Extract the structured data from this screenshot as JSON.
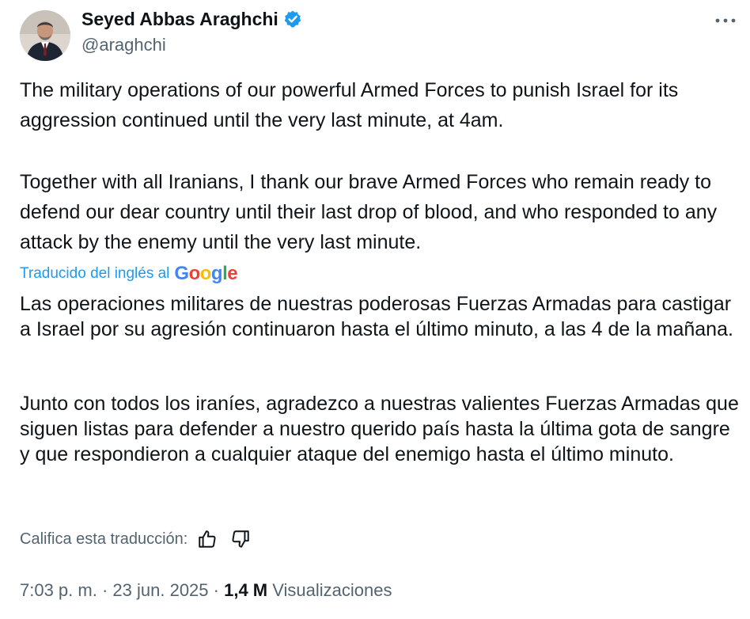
{
  "author": {
    "name": "Seyed Abbas Araghchi",
    "handle": "@araghchi",
    "verified_color": "#1d9bf0"
  },
  "tweet": {
    "paragraphs": [
      "The military operations of our powerful Armed Forces to punish Israel for its aggression continued until the very last minute, at 4am.",
      "Together with all Iranians, I thank our brave Armed Forces who remain ready to defend our dear country until their last drop of blood, and who responded to any attack by the enemy until the very last minute."
    ]
  },
  "translation": {
    "label": "Traducido del inglés al",
    "provider": "Google",
    "paragraphs": [
      "Las operaciones militares de nuestras poderosas Fuerzas Armadas para castigar a Israel por su agresión continuaron hasta el último minuto, a las 4 de la mañana.",
      "Junto con todos los iraníes, agradezco a nuestras valientes Fuerzas Armadas que siguen listas para defender a nuestro querido país hasta la última gota de sangre y que respondieron a cualquier ataque del enemigo hasta el último minuto."
    ],
    "rate_label": "Califica esta traducción:"
  },
  "meta": {
    "time": "7:03 p. m.",
    "separator": "·",
    "date": "23 jun. 2025",
    "views_count": "1,4 M",
    "views_label": "Visualizaciones"
  },
  "icons": {
    "more": "more-horizontal-icon",
    "verified": "verified-badge-icon",
    "thumbs_up": "thumbs-up-icon",
    "thumbs_down": "thumbs-down-icon"
  },
  "colors": {
    "accent": "#1d9bf0",
    "text": "#0f1419",
    "secondary": "#536471"
  }
}
